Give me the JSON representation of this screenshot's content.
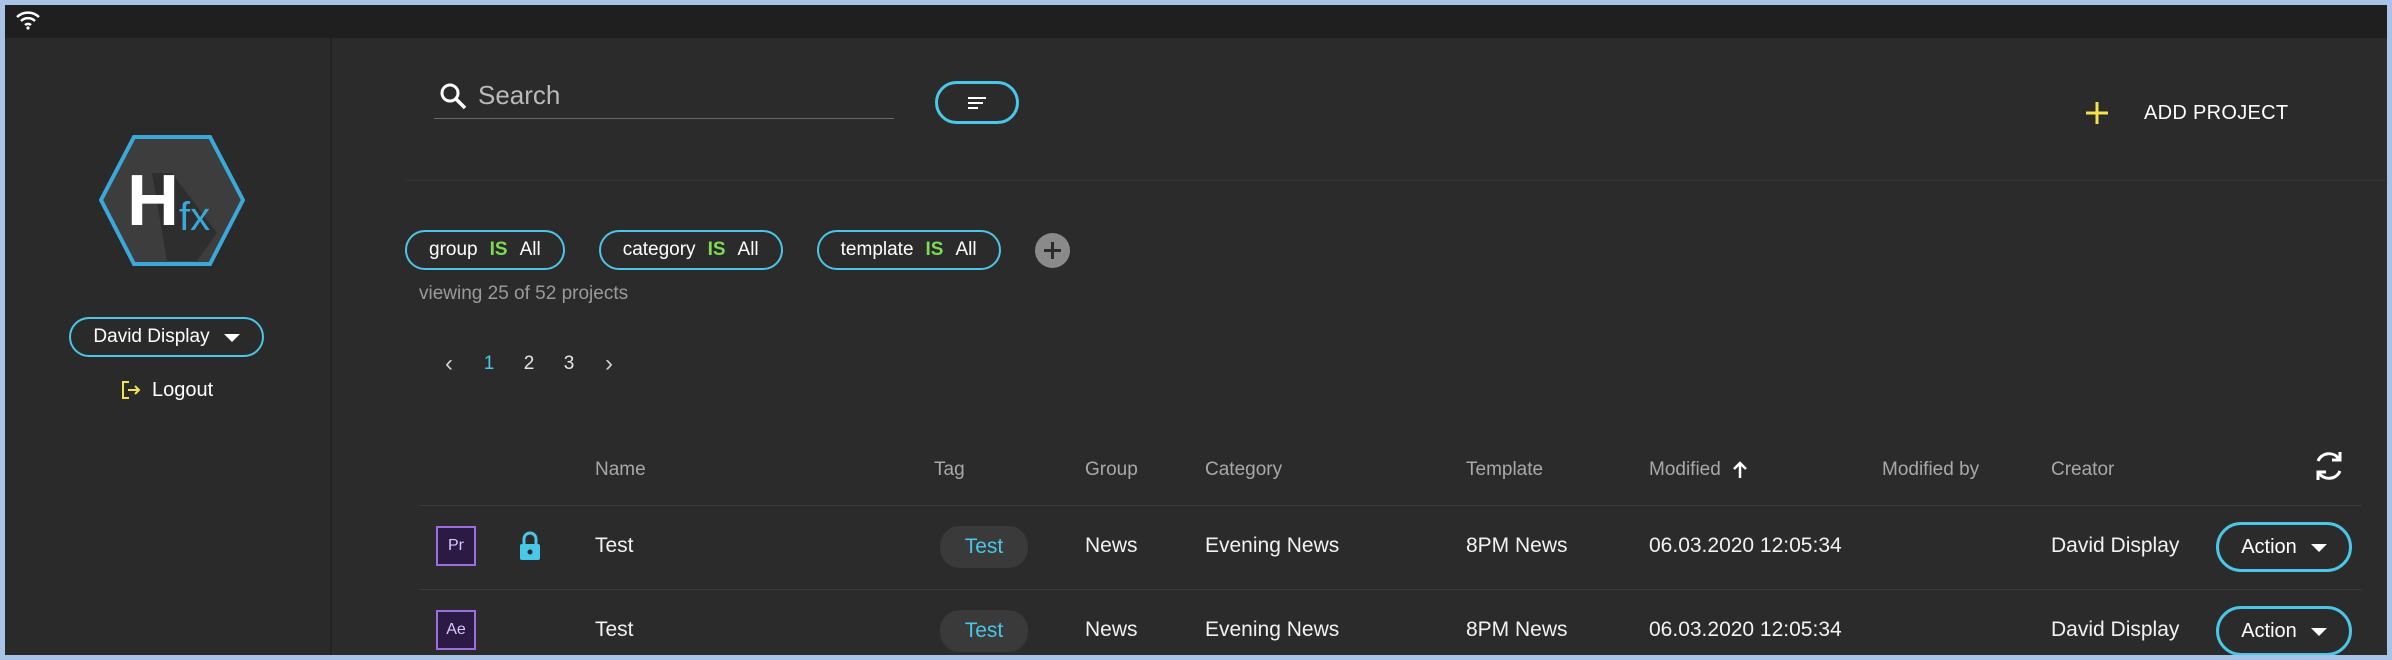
{
  "sidebar": {
    "logo_letter": "H",
    "logo_fx": "fx",
    "user_label": "David Display",
    "logout_label": "Logout"
  },
  "search": {
    "placeholder": "Search"
  },
  "add_project_label": "ADD PROJECT",
  "filters": [
    {
      "field": "group",
      "op": "IS",
      "value": "All"
    },
    {
      "field": "category",
      "op": "IS",
      "value": "All"
    },
    {
      "field": "template",
      "op": "IS",
      "value": "All"
    }
  ],
  "viewing_text": "viewing 25 of 52 projects",
  "pagination": {
    "pages": [
      "1",
      "2",
      "3"
    ],
    "current": "1"
  },
  "table": {
    "headers": {
      "name": "Name",
      "tag": "Tag",
      "group": "Group",
      "category": "Category",
      "template": "Template",
      "modified": "Modified",
      "modified_by": "Modified by",
      "creator": "Creator"
    },
    "rows": [
      {
        "app": "Pr",
        "locked": true,
        "name": "Test",
        "tag": "Test",
        "group": "News",
        "category": "Evening News",
        "template": "8PM News",
        "modified": "06.03.2020 12:05:34",
        "modified_by": "",
        "creator": "David Display",
        "action": "Action"
      },
      {
        "app": "Ae",
        "locked": false,
        "name": "Test",
        "tag": "Test",
        "group": "News",
        "category": "Evening News",
        "template": "8PM News",
        "modified": "06.03.2020 12:05:34",
        "modified_by": "",
        "creator": "David Display",
        "action": "Action"
      }
    ]
  },
  "colors": {
    "accent": "#4ac6e6",
    "is_green": "#7ed957",
    "add_yellow": "#f2e34b",
    "background": "#2b2b2b"
  }
}
